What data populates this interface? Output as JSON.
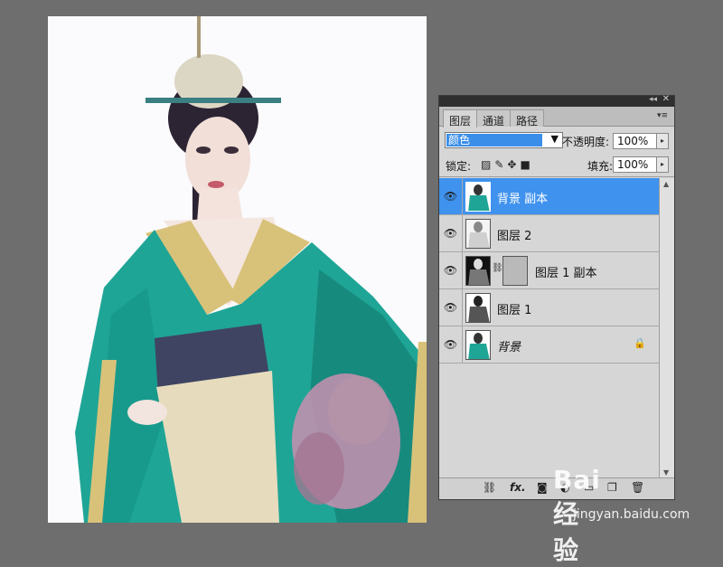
{
  "panel": {
    "tabs": [
      "图层",
      "通道",
      "路径"
    ],
    "blend_mode": "颜色",
    "opacity_label": "不透明度:",
    "opacity_value": "100%",
    "lock_label": "锁定:",
    "fill_label": "填充:",
    "fill_value": "100%",
    "layers": [
      {
        "name": "背景 副本",
        "selected": true,
        "locked": false
      },
      {
        "name": "图层 2",
        "selected": false,
        "locked": false
      },
      {
        "name": "图层 1 副本",
        "selected": false,
        "locked": false,
        "has_mask": true
      },
      {
        "name": "图层 1",
        "selected": false,
        "locked": false
      },
      {
        "name": "背景",
        "selected": false,
        "locked": true
      }
    ]
  },
  "icons": {
    "eye": "eye-icon",
    "lock": "lock-icon",
    "link": "link-icon",
    "fx": "fx-icon",
    "mask": "mask-icon",
    "adjust": "adjustment-icon",
    "group": "folder-icon",
    "new": "new-layer-icon",
    "trash": "trash-icon"
  },
  "watermark": {
    "logo": "Bai 经验",
    "url": "jingyan.baidu.com"
  },
  "colors": {
    "selection": "#3f92ee",
    "teal_robe": "#1fa596"
  }
}
